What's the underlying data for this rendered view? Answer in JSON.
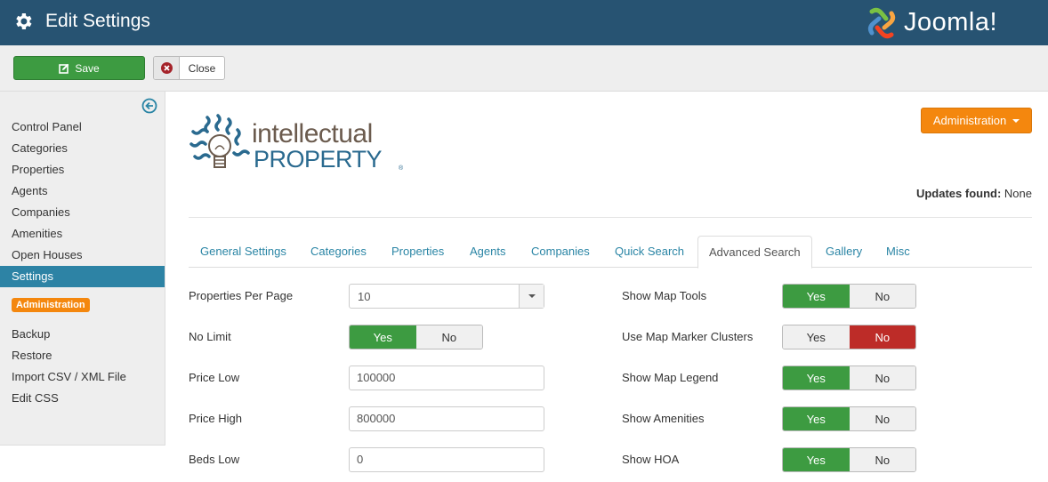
{
  "header": {
    "title": "Edit Settings",
    "brand": "Joomla!",
    "brand_reg": "®"
  },
  "toolbar": {
    "save_label": "Save",
    "close_label": "Close"
  },
  "sidebar": {
    "items": [
      {
        "label": "Control Panel"
      },
      {
        "label": "Categories"
      },
      {
        "label": "Properties"
      },
      {
        "label": "Agents"
      },
      {
        "label": "Companies"
      },
      {
        "label": "Amenities"
      },
      {
        "label": "Open Houses"
      },
      {
        "label": "Settings",
        "active": true
      }
    ],
    "badge": "Administration",
    "admin_items": [
      {
        "label": "Backup"
      },
      {
        "label": "Restore"
      },
      {
        "label": "Import CSV / XML File"
      },
      {
        "label": "Edit CSS"
      }
    ]
  },
  "logo": {
    "line1": "intellectual",
    "line2": "PROPERTY",
    "reg": "®"
  },
  "admin_button": "Administration",
  "updates": {
    "label": "Updates found:",
    "value": "None"
  },
  "tabs": [
    {
      "label": "General Settings"
    },
    {
      "label": "Categories"
    },
    {
      "label": "Properties"
    },
    {
      "label": "Agents"
    },
    {
      "label": "Companies"
    },
    {
      "label": "Quick Search"
    },
    {
      "label": "Advanced Search",
      "active": true
    },
    {
      "label": "Gallery"
    },
    {
      "label": "Misc"
    }
  ],
  "form": {
    "left": [
      {
        "label": "Properties Per Page",
        "type": "select",
        "value": "10"
      },
      {
        "label": "No Limit",
        "type": "toggle",
        "value": "Yes"
      },
      {
        "label": "Price Low",
        "type": "text",
        "value": "100000"
      },
      {
        "label": "Price High",
        "type": "text",
        "value": "800000"
      },
      {
        "label": "Beds Low",
        "type": "text",
        "value": "0"
      }
    ],
    "right": [
      {
        "label": "Show Map Tools",
        "value": "Yes"
      },
      {
        "label": "Use Map Marker Clusters",
        "value": "No"
      },
      {
        "label": "Show Map Legend",
        "value": "Yes"
      },
      {
        "label": "Show Amenities",
        "value": "Yes"
      },
      {
        "label": "Show HOA",
        "value": "Yes"
      }
    ],
    "yes_label": "Yes",
    "no_label": "No"
  },
  "colors": {
    "header": "#275372",
    "save": "#3d9b41",
    "accent": "#2d83a5",
    "orange": "#f4870e",
    "danger": "#bd2c28"
  }
}
